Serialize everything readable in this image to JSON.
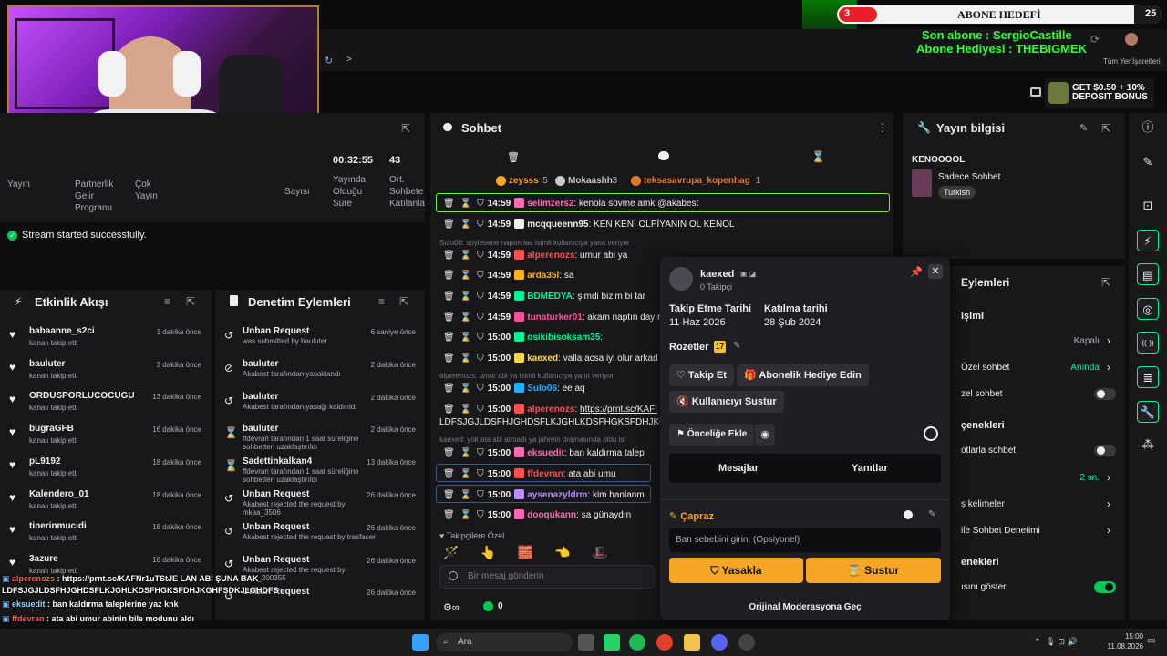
{
  "overlay": {
    "goal_title": "ABONE HEDEFİ",
    "goal_current": "3",
    "goal_target": "25",
    "last_sub": "Son abone : SergioCastille",
    "gift_sub": "Abone Hediyesi : THEBIGMEK",
    "bookmarks": "Tüm Yer İşaretleri",
    "promo": "GET $0.50 + 10%\nDEPOSIT BONUS"
  },
  "stats": {
    "labels": [
      "Yayın",
      "Partnerlik Gelir Programı",
      "Çok Yayın",
      "Yayında Olduğu Süre",
      "Ort. Sohbete Katılanla"
    ],
    "uptime": "00:32:55",
    "chatters": "43",
    "followers_label": "Sayısı",
    "toast": "Stream started successfully."
  },
  "chat": {
    "title": "Sohbet",
    "top": [
      {
        "name": "zeysss",
        "count": "5"
      },
      {
        "name": "Mokaashh",
        "count": "3"
      },
      {
        "name": "teksasavrupa_kopenhag",
        "count": "1"
      }
    ],
    "lines": [
      {
        "time": "14:59",
        "user": "selimzers2",
        "color": "#ff69b4",
        "text": "kenola sovme amk @akabest",
        "highlight": true
      },
      {
        "time": "14:59",
        "user": "mcqqueenn95",
        "color": "#efeff1",
        "text": "KEN KENİ OLPİYANIN OL KENOL"
      },
      {
        "reply": "Sulo06: söylesene naptın laa isimli kullanıcıya yanıt veriyor"
      },
      {
        "time": "14:59",
        "user": "alperenozs",
        "color": "#ff4f4f",
        "text": "umur abi ya"
      },
      {
        "time": "14:59",
        "user": "arda35l",
        "color": "#ffb31a",
        "text": "sa"
      },
      {
        "time": "14:59",
        "user": "BDMEDYA",
        "color": "#00f593",
        "text": "şimdi bizim bi tar"
      },
      {
        "time": "14:59",
        "user": "tunaturker01",
        "color": "#ff4f9a",
        "text": "akam naptın dayır"
      },
      {
        "time": "15:00",
        "user": "osikibisoksam35",
        "color": "#00f593",
        "text": ""
      },
      {
        "time": "15:00",
        "user": "kaexed",
        "color": "#ffd84a",
        "text": "valla acsa iyi olur arkad"
      },
      {
        "reply": "alperenozs: umur abi ya isimli kullanıcıya yanıt veriyor"
      },
      {
        "time": "15:00",
        "user": "Sulo06",
        "color": "#1fb0ff",
        "text": "ee aq"
      },
      {
        "time": "15:00",
        "user": "alperenozs",
        "color": "#ff4f4f",
        "text": "https://prnt.sc/KAFI"
      },
      {
        "cont": "LDFSJGJLDSFHJGHDSFLKJGHLKDSFHGKSFDHJKG"
      },
      {
        "reply": "kaexed: yok ata abi atmadı ya jahrein dramasında oldu isl"
      },
      {
        "time": "15:00",
        "user": "eksuedit",
        "color": "#ff69b4",
        "text": "ban kaldırma talep"
      },
      {
        "time": "15:00",
        "user": "ffdevran",
        "color": "#ff4f4f",
        "text": "ata abi umu",
        "boxed": true
      },
      {
        "time": "15:00",
        "user": "aysenazyldrm",
        "color": "#b78cff",
        "text": "kim banlanm",
        "boxed": true
      },
      {
        "time": "15:00",
        "user": "dooqukann",
        "color": "#ff69b4",
        "text": "sa günaydın"
      }
    ],
    "followers_only": "Takipçilere Özel",
    "input_placeholder": "Bir mesaj gönderin",
    "points": "0"
  },
  "popup": {
    "username": "kaexed",
    "followers": "0 Takipçi",
    "follow_date_label": "Takip Etme Tarihi",
    "follow_date": "11 Haz 2026",
    "join_date_label": "Katılma tarihi",
    "join_date": "28 Şub 2024",
    "badges_label": "Rozetler",
    "badge": "17",
    "follow_btn": "Takip Et",
    "gift_btn": "Abonelik Hediye Edin",
    "mute_btn": "Kullanıcıyı Sustur",
    "priority_btn": "Önceliğe Ekle",
    "tab_messages": "Mesajlar",
    "tab_replies": "Yanıtlar",
    "section": "Çapraz",
    "reason_placeholder": "Ban sebebini girin. (Opsiyonel)",
    "ban_btn": "Yasakla",
    "timeout_btn": "Sustur",
    "footer": "Orijinal Moderasyona Geç"
  },
  "info": {
    "title": "Yayın bilgisi",
    "stream_title": "KENOOOOL",
    "category": "Sadece Sohbet",
    "tag": "Turkish",
    "actions_title": "Eylemleri",
    "rows": [
      {
        "label": "işimi",
        "value": ""
      },
      {
        "label": "",
        "value": "Kapalı"
      },
      {
        "label": "Özel sohbet",
        "value": "Anında"
      },
      {
        "label": "zel sohbet",
        "value": "toggle-off"
      },
      {
        "label": "çenekleri",
        "value": ""
      },
      {
        "label": "otlarla sohbet",
        "value": "toggle-off"
      },
      {
        "label": "",
        "value": "2 sn."
      },
      {
        "label": "ş kelimeler",
        "value": ""
      },
      {
        "label": "ile Sohbet Denetimi",
        "value": ""
      },
      {
        "label": "enekleri",
        "value": ""
      },
      {
        "label": "ısını göster",
        "value": "toggle-on"
      }
    ]
  },
  "feed": {
    "title": "Etkinlik Akışı",
    "items": [
      {
        "name": "babaanne_s2ci",
        "sub": "kanalı takip etti",
        "time": "1 dakika önce"
      },
      {
        "name": "bauluter",
        "sub": "kanalı takip etti",
        "time": "3 dakika önce"
      },
      {
        "name": "ORDUSPORLUCOCUGU",
        "sub": "kanalı takip etti",
        "time": "13 dakika önce"
      },
      {
        "name": "bugraGFB",
        "sub": "kanalı takip etti",
        "time": "16 dakika önce"
      },
      {
        "name": "pL9192",
        "sub": "kanalı takip etti",
        "time": "18 dakika önce"
      },
      {
        "name": "Kalendero_01",
        "sub": "kanalı takip etti",
        "time": "18 dakika önce"
      },
      {
        "name": "tinerinmucidi",
        "sub": "kanalı takip etti",
        "time": "18 dakika önce"
      },
      {
        "name": "3azure",
        "sub": "kanalı takip etti",
        "time": "18 dakika önce"
      }
    ]
  },
  "mod": {
    "title": "Denetim Eylemleri",
    "items": [
      {
        "name": "Unban Request",
        "sub": "was submitted by bauluter",
        "time": "6 saniye önce"
      },
      {
        "name": "bauluter",
        "sub": "Akabest tarafından yasaklandı",
        "time": "2 dakika önce"
      },
      {
        "name": "bauluter",
        "sub": "Akabest tarafından yasağı kaldırıldı",
        "time": "2 dakika önce"
      },
      {
        "name": "bauluter",
        "sub": "ffdevran tarafından 1 saat süreliğine sohbetten uzaklaştırıldı",
        "time": "2 dakika önce"
      },
      {
        "name": "Sadettinkalkan4",
        "sub": "ffdevran tarafından 1 saat süreliğine sohbetten uzaklaştırıldı",
        "time": "13 dakika önce"
      },
      {
        "name": "Unban Request",
        "sub": "Akabest rejected the request by mkaa_3506",
        "time": "26 dakika önce"
      },
      {
        "name": "Unban Request",
        "sub": "Akabest rejected the request by trasfacer",
        "time": "26 dakika önce"
      },
      {
        "name": "Unban Request",
        "sub": "Akabest rejected the request by Emir_200355",
        "time": "26 dakika önce"
      },
      {
        "name": "Unban Request",
        "sub": "",
        "time": "26 dakika önce"
      }
    ]
  },
  "overlay_chat": [
    {
      "user": "alperenozs",
      "text": "https://prnt.sc/KAFNr1uTStJE LAN ABİ ŞUNA BAK"
    },
    {
      "user": "",
      "text": "LDFSJGJLDSFHJGHDSFLKJGHLKDSFHGKSFDHJKGHFSDKJLGHDFS"
    },
    {
      "user": "eksuedit",
      "text": "ban kaldırma taleplerine yaz knk"
    },
    {
      "user": "ffdevran",
      "text": "ata abi umur abinin bile modunu aldı"
    },
    {
      "user": "aysenazyldrm",
      "text": "kim banlanmış"
    },
    {
      "user": "dooqukann",
      "text": "sa günaydın"
    }
  ],
  "taskbar": {
    "search": "Ara",
    "time": "15:00",
    "date": "11.08.2026"
  }
}
